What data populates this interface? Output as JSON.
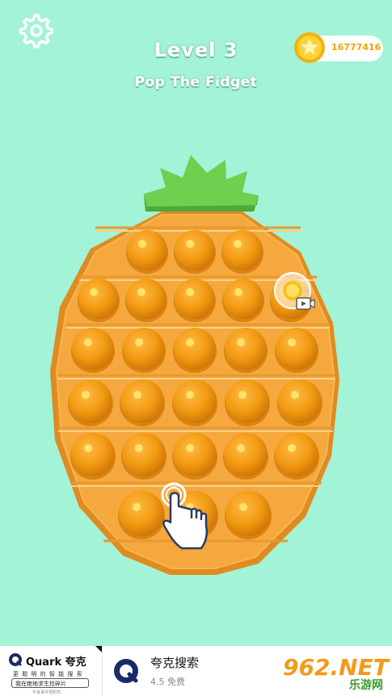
{
  "hud": {
    "level_label": "Level 3",
    "subtitle": "Pop The Fidget",
    "coins": "16777416"
  },
  "icons": {
    "settings": "gear-icon",
    "coin": "star-coin-icon",
    "video": "video-ad-icon",
    "hand": "tap-hint-hand-icon"
  },
  "colors": {
    "background": "#a3f3d6",
    "board": "#f5a73c",
    "bubble": "#f29a12",
    "leaves": "#6fcf4e",
    "coin": "#f7c313"
  },
  "game": {
    "shape": "pineapple",
    "rows": [
      3,
      5,
      5,
      5,
      5,
      3
    ]
  },
  "ad": {
    "brand": "Quark 夸克",
    "slogan": "更 聪 明 的 智 能 搜 索",
    "search_box": "我在绝地求生捡碎片",
    "fine_print": "不良事件预防司",
    "app_name": "夸克搜索",
    "app_rating": "4.5 免费"
  },
  "watermark": {
    "text": "962.NET",
    "sub": "乐游网"
  }
}
